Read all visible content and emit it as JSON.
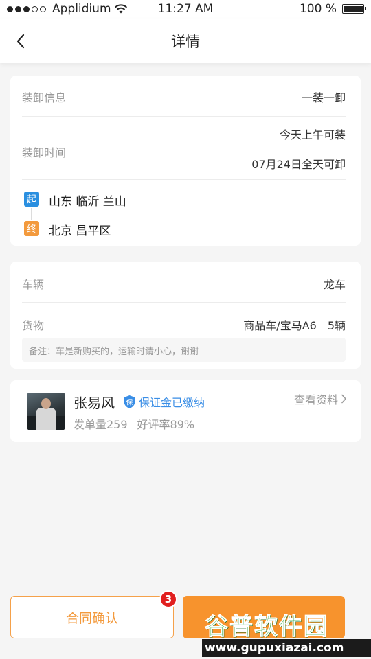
{
  "status_bar": {
    "carrier": "Applidium",
    "time": "11:27 AM",
    "battery": "100 %",
    "signal_bars_filled": 3,
    "signal_bars_total": 5
  },
  "nav": {
    "title": "详情",
    "back_icon": "chevron-left-icon"
  },
  "loading": {
    "info_label": "装卸信息",
    "info_value": "一装一卸",
    "time_label": "装卸时间",
    "load_time": "今天上午可装",
    "unload_time": "07月24日全天可卸",
    "origin_badge": "起",
    "origin": "山东 临沂 兰山",
    "dest_badge": "终",
    "destination": "北京 昌平区",
    "origin_color": "#2a8fe0",
    "dest_color": "#f39a3d"
  },
  "cargo": {
    "vehicle_label": "车辆",
    "vehicle_value": "龙车",
    "goods_label": "货物",
    "goods_value": "商品车/宝马A6　5辆",
    "remark": "备注：车是新购买的，运输时请小心，谢谢"
  },
  "shipper": {
    "name": "张易风",
    "deposit_badge": "保",
    "deposit_text": "保证金已缴纳",
    "orders": "发单量259",
    "rating": "好评率89%",
    "view_profile": "查看资料"
  },
  "footer": {
    "contract_label": "合同确认",
    "notification_count": "3",
    "accent": "#f7932d"
  },
  "watermark": {
    "title": "谷普软件园",
    "url": "www.gupuxiazai.com"
  }
}
